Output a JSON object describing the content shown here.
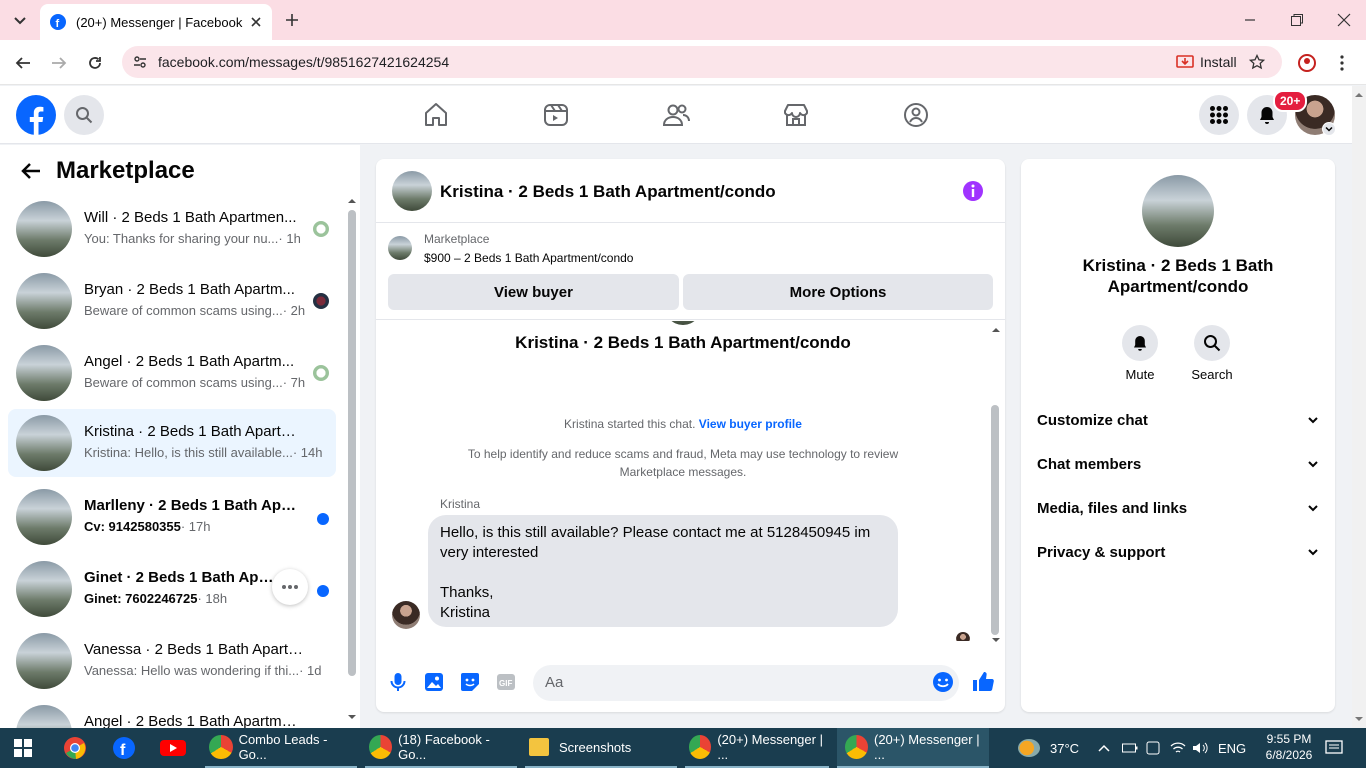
{
  "browser": {
    "tab_title": "(20+) Messenger | Facebook",
    "url": "facebook.com/messages/t/9851627421624254",
    "install_label": "Install"
  },
  "header": {
    "notifications_badge": "20+"
  },
  "left": {
    "title": "Marketplace",
    "conversations": [
      {
        "name": "Will · 2 Beds 1 Bath Apartmen...",
        "preview": "You: Thanks for sharing your nu...",
        "time": " · 1h"
      },
      {
        "name": "Bryan · 2 Beds 1 Bath Apartm...",
        "preview": "Beware of common scams using...",
        "time": " · 2h"
      },
      {
        "name": "Angel · 2 Beds 1 Bath Apartm...",
        "preview": "Beware of common scams using...",
        "time": " · 7h"
      },
      {
        "name": "Kristina · 2 Beds 1 Bath Apartme...",
        "preview": "Kristina: Hello, is this still available...",
        "time": " · 14h"
      },
      {
        "name": "Marlleny · 2 Beds 1 Bath Apart...",
        "preview": "Cv: 9142580355",
        "time": " · 17h"
      },
      {
        "name": "Ginet · 2 Beds 1 Bath Apartm...",
        "preview": "Ginet: 7602246725",
        "time": " · 18h"
      },
      {
        "name": "Vanessa · 2 Beds 1 Bath Apartme...",
        "preview": "Vanessa: Hello was wondering if thi...",
        "time": " · 1d"
      },
      {
        "name": "Angel · 2 Beds 1 Bath Apartment...",
        "preview": "",
        "time": ""
      }
    ]
  },
  "chat": {
    "title": "Kristina · 2 Beds 1 Bath Apartment/condo",
    "marketplace_label": "Marketplace",
    "listing": "$900 – 2 Beds 1 Bath Apartment/condo",
    "view_buyer": "View buyer",
    "more_options": "More Options",
    "thread_name": "Kristina · 2 Beds 1 Bath Apartment/condo",
    "started_text": "Kristina started this chat.",
    "view_profile": "View buyer profile",
    "notice": "To help identify and reduce scams and fraud, Meta may use technology to review Marketplace messages.",
    "sender": "Kristina",
    "message": "Hello, is this still available? Please contact me at 5128450945 im very interested\n\nThanks,\nKristina",
    "input_placeholder": "Aa"
  },
  "details": {
    "name": "Kristina · 2 Beds 1 Bath Apartment/condo",
    "mute": "Mute",
    "search": "Search",
    "sections": [
      "Customize chat",
      "Chat members",
      "Media, files and links",
      "Privacy & support"
    ]
  },
  "taskbar": {
    "items": [
      "Combo Leads - Go...",
      "(18) Facebook - Go...",
      "Screenshots",
      "(20+) Messenger | ...",
      "(20+) Messenger | ..."
    ],
    "weather": "37°C",
    "lang": "ENG",
    "time": "9:55 PM",
    "date": "6/8/2026"
  }
}
